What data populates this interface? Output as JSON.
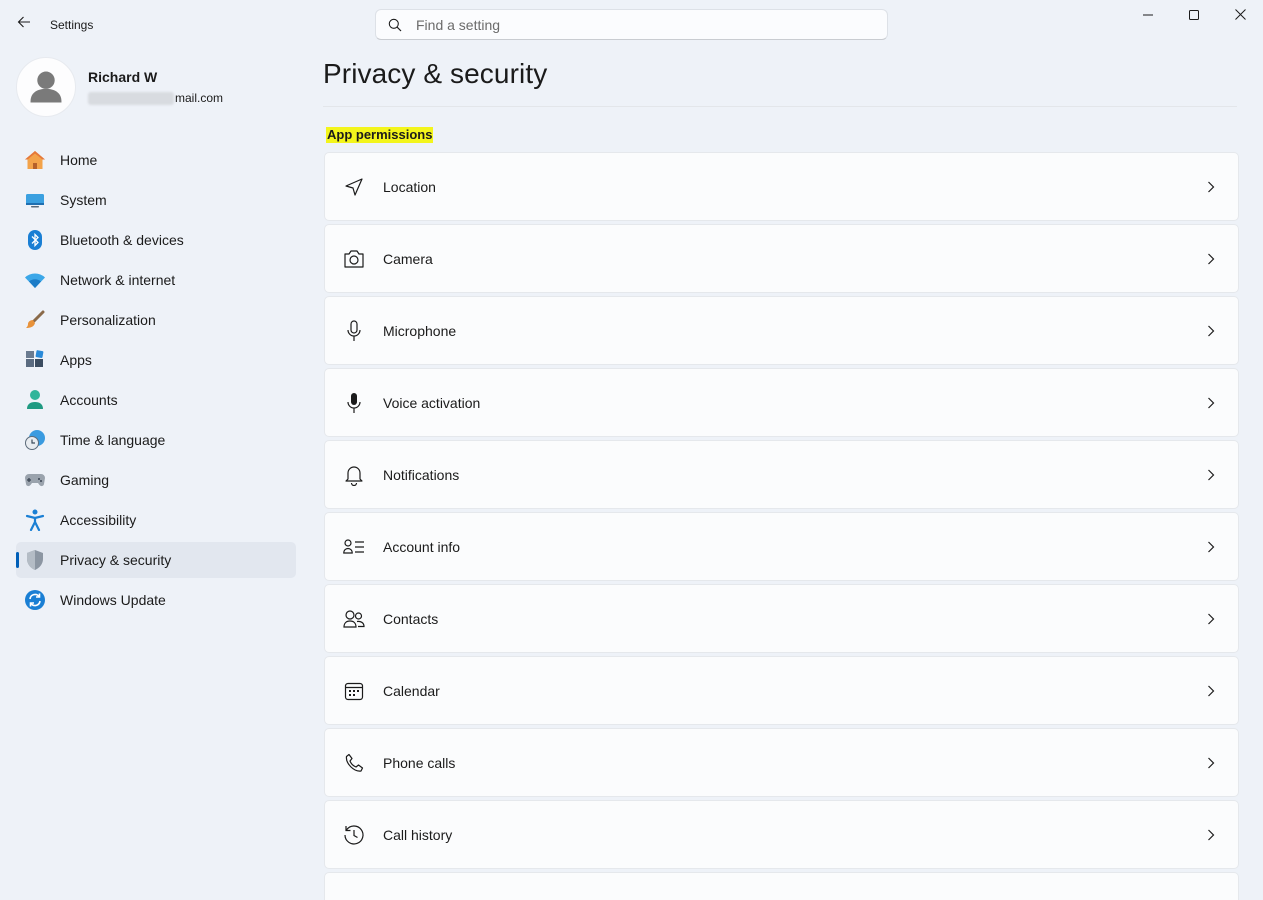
{
  "window": {
    "app_title": "Settings",
    "back_icon": "back-arrow-icon",
    "controls": [
      "minimize-icon",
      "maximize-icon",
      "close-icon"
    ]
  },
  "search": {
    "placeholder": "Find a setting",
    "value": ""
  },
  "profile": {
    "name": "Richard W",
    "email_visible": "mail.com"
  },
  "sidebar": {
    "items": [
      {
        "label": "Home",
        "icon": "home-icon"
      },
      {
        "label": "System",
        "icon": "system-icon"
      },
      {
        "label": "Bluetooth & devices",
        "icon": "bluetooth-icon"
      },
      {
        "label": "Network & internet",
        "icon": "wifi-icon"
      },
      {
        "label": "Personalization",
        "icon": "brush-icon"
      },
      {
        "label": "Apps",
        "icon": "apps-icon"
      },
      {
        "label": "Accounts",
        "icon": "accounts-icon"
      },
      {
        "label": "Time & language",
        "icon": "time-language-icon"
      },
      {
        "label": "Gaming",
        "icon": "gamepad-icon"
      },
      {
        "label": "Accessibility",
        "icon": "accessibility-icon"
      },
      {
        "label": "Privacy & security",
        "icon": "shield-icon",
        "active": true
      },
      {
        "label": "Windows Update",
        "icon": "update-icon"
      }
    ]
  },
  "main": {
    "title": "Privacy & security",
    "section_title": "App permissions",
    "permissions": [
      {
        "label": "Location",
        "icon": "location-icon"
      },
      {
        "label": "Camera",
        "icon": "camera-icon"
      },
      {
        "label": "Microphone",
        "icon": "microphone-icon"
      },
      {
        "label": "Voice activation",
        "icon": "voice-activation-icon"
      },
      {
        "label": "Notifications",
        "icon": "bell-icon"
      },
      {
        "label": "Account info",
        "icon": "account-info-icon"
      },
      {
        "label": "Contacts",
        "icon": "contacts-icon"
      },
      {
        "label": "Calendar",
        "icon": "calendar-icon"
      },
      {
        "label": "Phone calls",
        "icon": "phone-icon"
      },
      {
        "label": "Call history",
        "icon": "history-icon"
      }
    ]
  },
  "colors": {
    "accent": "#005fb8",
    "highlight": "#f3f51c",
    "background": "#eef2f8",
    "card": "#fbfcfd"
  }
}
